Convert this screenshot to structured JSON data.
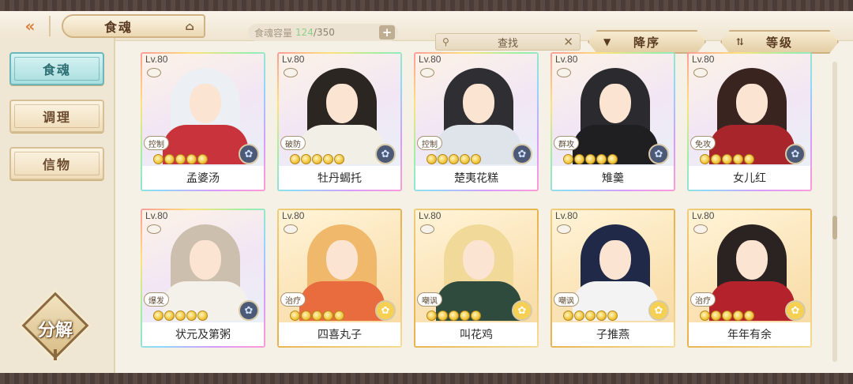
{
  "header": {
    "back_icon": "double-chevron-left",
    "title": "食魂",
    "title_icon": "pavilion-icon",
    "capacity": {
      "label": "食魂容量",
      "used": "124",
      "total": "/350",
      "add_label": "+"
    },
    "search": {
      "placeholder": "查找"
    },
    "sort_desc_label": "降序",
    "sort_level_label": "等级"
  },
  "sidebar": {
    "items": [
      {
        "label": "食魂",
        "active": true
      },
      {
        "label": "调理",
        "active": false
      },
      {
        "label": "信物",
        "active": false
      }
    ],
    "decompose_label": "分解"
  },
  "colors": {
    "accent_teal": "#a9dedf",
    "gold_star": "#f1c53b",
    "rainbow_frame": "#ff9ad6",
    "gold_frame": "#e8b24e"
  },
  "cards": [
    {
      "level": "Lv.80",
      "role": "控制",
      "name": "孟婆汤",
      "element": "blue",
      "frame": "rainbow",
      "hair": "#eceff3",
      "outfit": "#c9343c"
    },
    {
      "level": "Lv.80",
      "role": "破防",
      "name": "牡丹蝎托",
      "element": "blue",
      "frame": "rainbow",
      "hair": "#2b2622",
      "outfit": "#f2efe6"
    },
    {
      "level": "Lv.80",
      "role": "控制",
      "name": "楚夷花糕",
      "element": "blue",
      "frame": "rainbow",
      "hair": "#2e2e33",
      "outfit": "#dfe4ea"
    },
    {
      "level": "Lv.80",
      "role": "群攻",
      "name": "雉羹",
      "element": "blue",
      "frame": "rainbow",
      "hair": "#2b2a2e",
      "outfit": "#1f1f22"
    },
    {
      "level": "Lv.80",
      "role": "免攻",
      "name": "女儿红",
      "element": "blue",
      "frame": "rainbow",
      "hair": "#3a2420",
      "outfit": "#a8262b"
    },
    {
      "level": "Lv.80",
      "role": "爆发",
      "name": "状元及第粥",
      "element": "blue",
      "frame": "rainbow",
      "hair": "#cdbfae",
      "outfit": "#f4f1ea"
    },
    {
      "level": "Lv.80",
      "role": "治疗",
      "name": "四喜丸子",
      "element": "yellow",
      "frame": "gold",
      "hair": "#f0b86a",
      "outfit": "#e86c3e"
    },
    {
      "level": "Lv.80",
      "role": "嘲讽",
      "name": "叫花鸡",
      "element": "yellow",
      "frame": "gold",
      "hair": "#f1d99a",
      "outfit": "#2f4b3e"
    },
    {
      "level": "Lv.80",
      "role": "嘲讽",
      "name": "子推燕",
      "element": "yellow",
      "frame": "gold",
      "hair": "#202a48",
      "outfit": "#f3f3f3"
    },
    {
      "level": "Lv.80",
      "role": "治疗",
      "name": "年年有余",
      "element": "yellow",
      "frame": "gold",
      "hair": "#2a2322",
      "outfit": "#b4232b"
    }
  ]
}
